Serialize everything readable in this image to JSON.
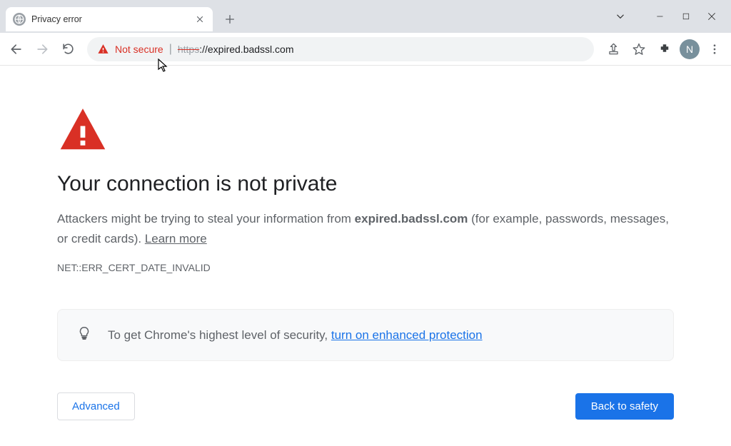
{
  "tab": {
    "title": "Privacy error"
  },
  "window": {
    "profile_initial": "N"
  },
  "toolbar": {
    "not_secure_label": "Not secure",
    "url_scheme": "https",
    "url_rest": "://expired.badssl.com"
  },
  "interstitial": {
    "heading": "Your connection is not private",
    "body_prefix": "Attackers might be trying to steal your information from ",
    "body_host": "expired.badssl.com",
    "body_suffix": " (for example, passwords, messages, or credit cards). ",
    "learn_more": "Learn more",
    "error_code": "NET::ERR_CERT_DATE_INVALID",
    "tip_prefix": "To get Chrome's highest level of security, ",
    "tip_link": "turn on enhanced protection",
    "advanced_label": "Advanced",
    "back_label": "Back to safety"
  }
}
